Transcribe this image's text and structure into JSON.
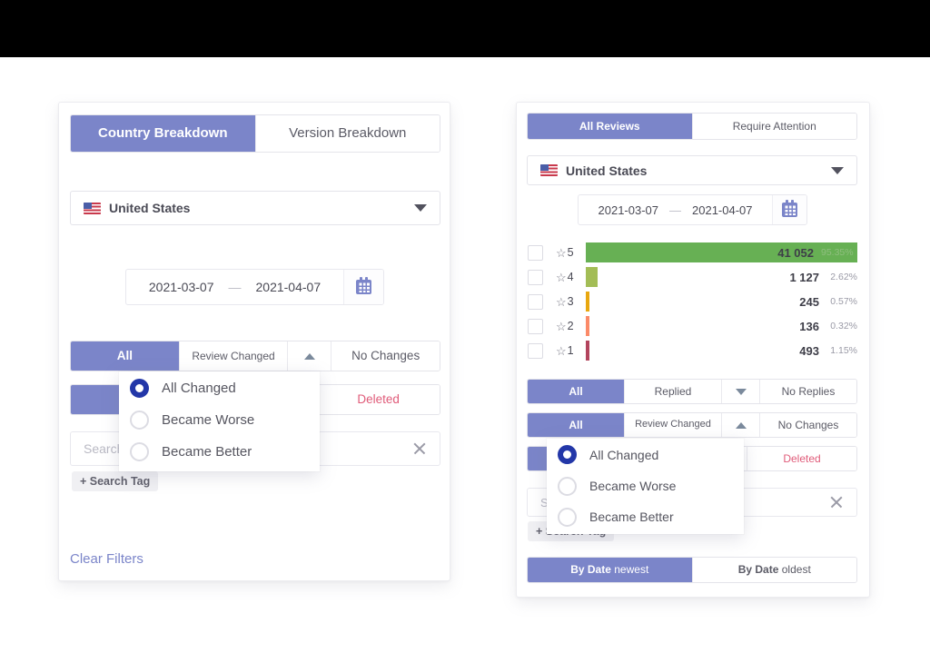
{
  "accent": "#7b85c9",
  "left_panel": {
    "tabs": [
      {
        "label": "Country Breakdown",
        "active": true
      },
      {
        "label": "Version Breakdown",
        "active": false
      }
    ],
    "country": {
      "label": "United States",
      "flag": "us-flag-icon",
      "chevron": "chevron-down-icon"
    },
    "date_range": {
      "from": "2021-03-07",
      "to": "2021-04-07",
      "separator": "—",
      "calendar_icon": "calendar-icon"
    },
    "review_changed_row": {
      "all": "All",
      "review_changed": "Review Changed",
      "caret": "caret-up-icon",
      "no_changes": "No Changes"
    },
    "hidden_row": {
      "deleted": "Deleted"
    },
    "search": {
      "placeholder": "Search",
      "value": "",
      "clear_icon": "close-icon"
    },
    "search_tag": "+ Search Tag",
    "clear_filters": "Clear Filters",
    "dropdown": {
      "options": [
        {
          "label": "All Changed",
          "selected": true
        },
        {
          "label": "Became Worse",
          "selected": false
        },
        {
          "label": "Became Better",
          "selected": false
        }
      ]
    }
  },
  "right_panel": {
    "tabs": [
      {
        "label": "All Reviews",
        "active": true
      },
      {
        "label": "Require Attention",
        "active": false
      }
    ],
    "country": {
      "label": "United States",
      "flag": "us-flag-icon",
      "chevron": "chevron-down-icon"
    },
    "date_range": {
      "from": "2021-03-07",
      "to": "2021-04-07",
      "separator": "—",
      "calendar_icon": "calendar-icon"
    },
    "replies_row": {
      "all": "All",
      "replied": "Replied",
      "caret": "caret-down-icon",
      "no_replies": "No Replies"
    },
    "review_changed_row": {
      "all": "All",
      "review_changed": "Review Changed",
      "caret": "caret-up-icon",
      "no_changes": "No Changes"
    },
    "hidden_row": {
      "deleted": "Deleted"
    },
    "search": {
      "placeholder": "Search",
      "value": "",
      "clear_icon": "close-icon"
    },
    "search_tag": "+ Search Tag",
    "sort": [
      {
        "bold": "By Date",
        "light": "newest",
        "active": true
      },
      {
        "bold": "By Date",
        "light": "oldest",
        "active": false
      }
    ],
    "dropdown": {
      "options": [
        {
          "label": "All Changed",
          "selected": true
        },
        {
          "label": "Became Worse",
          "selected": false
        },
        {
          "label": "Became Better",
          "selected": false
        }
      ]
    }
  },
  "chart_data": {
    "type": "bar",
    "title": "",
    "xlabel": "",
    "ylabel": "",
    "orientation": "horizontal",
    "categories": [
      "5",
      "4",
      "3",
      "2",
      "1"
    ],
    "values": [
      41052,
      1127,
      245,
      136,
      493
    ],
    "value_labels": [
      "41 052",
      "1 127",
      "245",
      "136",
      "493"
    ],
    "percent_labels": [
      "95.35%",
      "2.62%",
      "0.57%",
      "0.32%",
      "1.15%"
    ],
    "percents": [
      95.35,
      2.62,
      0.57,
      0.32,
      1.15
    ],
    "bar_colors": [
      "#67b054",
      "#a3bd56",
      "#e8a70f",
      "#fb8a68",
      "#b2445d"
    ],
    "bar_widths_pct": [
      100,
      4.2,
      1.2,
      1.2,
      1.2
    ],
    "star_glyph": "☆",
    "grid": false,
    "legend": "none"
  }
}
